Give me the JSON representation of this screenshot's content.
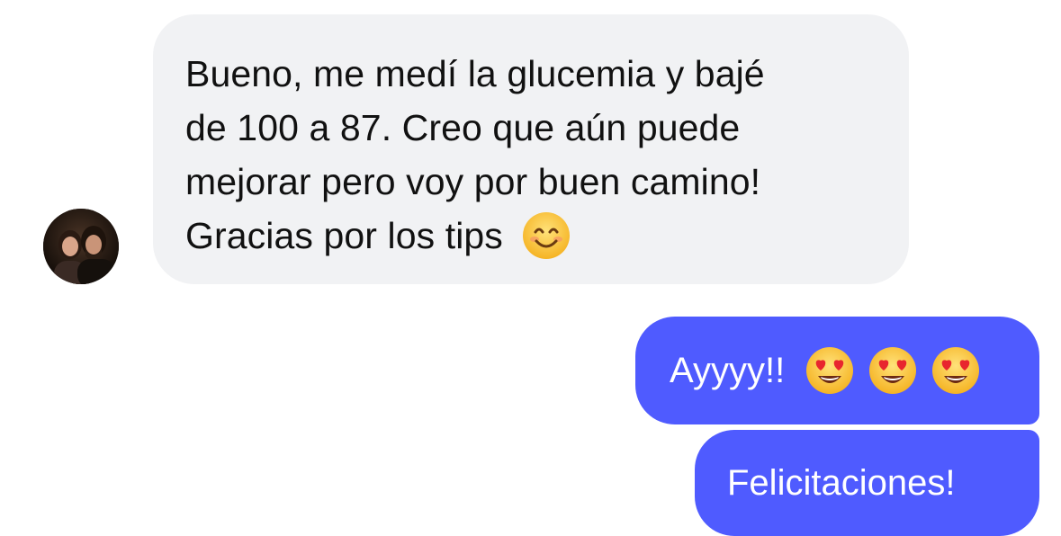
{
  "conversation": {
    "incoming": {
      "avatar_icon": "user-avatar-photo",
      "lines": [
        "Bueno, me medí la glucemia y bajé",
        "de 100 a 87. Creo que aún puede",
        "mejorar pero voy por buen camino!",
        "Gracias por los tips"
      ],
      "trailing_emoji": "smiling-face-icon",
      "bubble_color": "#f1f2f4",
      "text_color": "#111111"
    },
    "outgoing": [
      {
        "text": "Ayyyy!!",
        "emojis": [
          "heart-eyes-icon",
          "heart-eyes-icon",
          "heart-eyes-icon"
        ]
      },
      {
        "text": "Felicitaciones!"
      }
    ],
    "outgoing_bubble_color": "#4f5bff",
    "outgoing_text_color": "#ffffff"
  }
}
